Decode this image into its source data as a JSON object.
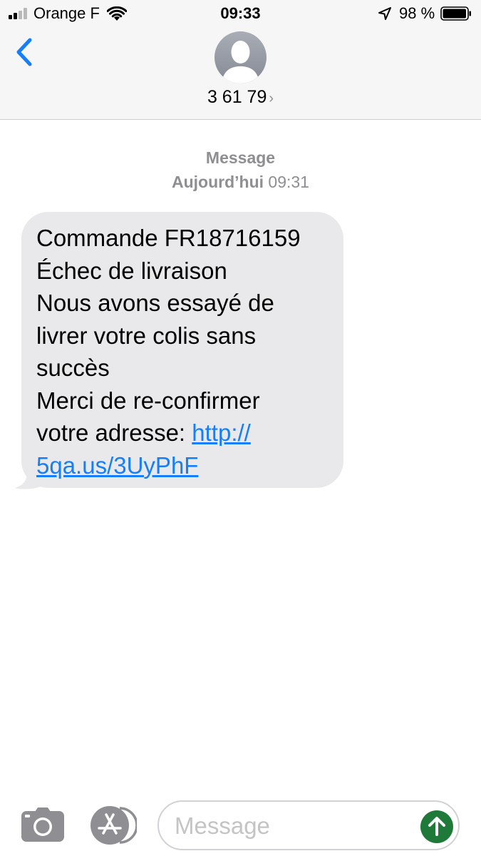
{
  "status_bar": {
    "carrier": "Orange F",
    "time": "09:33",
    "battery_percent": "98 %",
    "signal_icon": "cellular-signal-icon",
    "wifi_icon": "wifi-icon",
    "location_icon": "location-arrow-icon",
    "battery_icon": "battery-icon"
  },
  "header": {
    "back_icon": "chevron-left-icon",
    "avatar_icon": "person-silhouette-icon",
    "contact_name": "3 61 79",
    "contact_chevron": "›"
  },
  "conversation": {
    "service_label": "Message",
    "date_day": "Aujourd’hui",
    "date_time": "09:31",
    "message": {
      "lines": [
        "Commande FR18716159",
        "Échec de livraison",
        "Nous avons essayé de",
        "livrer votre colis sans",
        "succès",
        "Merci de re-confirmer",
        "votre adresse: "
      ],
      "link_part1": "http://",
      "link_part2": "5qa.us/3UyPhF"
    }
  },
  "input_bar": {
    "camera_icon": "camera-icon",
    "appstore_icon": "app-store-icon",
    "placeholder": "Message",
    "send_icon": "send-arrow-up-icon"
  },
  "colors": {
    "accent_blue": "#147efb",
    "bubble_gray": "#e9e9eb",
    "header_bg": "#f6f6f6",
    "send_green": "#1f7a3a",
    "meta_gray": "#8e8e93"
  }
}
